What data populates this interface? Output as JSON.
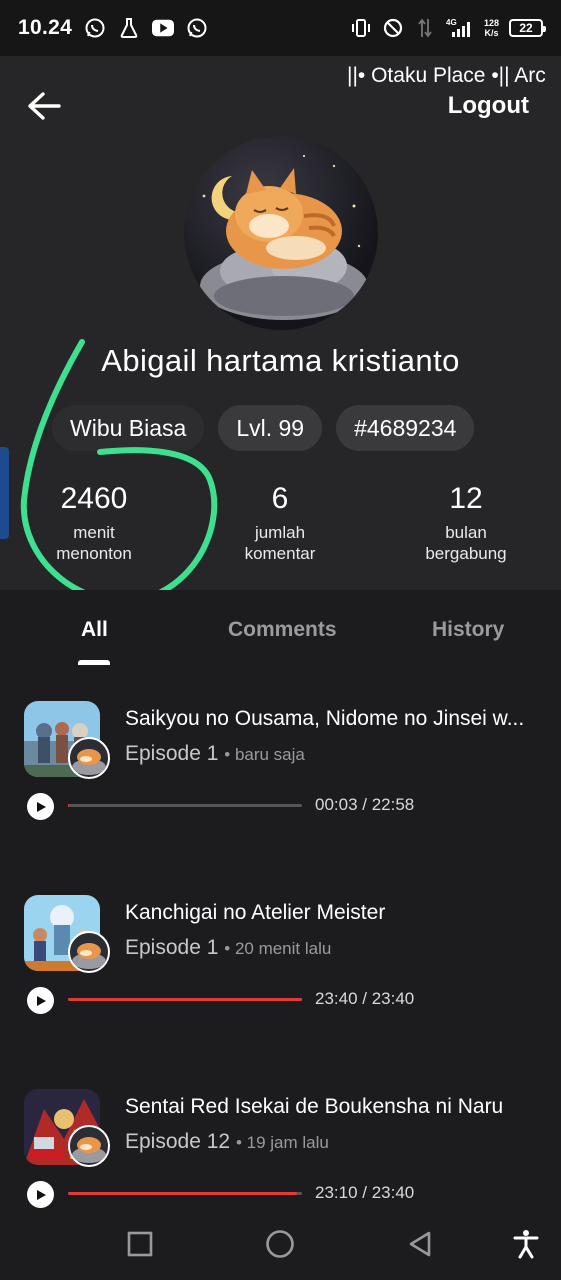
{
  "status_bar": {
    "time": "10.24",
    "left_icons": [
      "whatsapp-icon",
      "flask-icon",
      "youtube-icon",
      "whatsapp-icon"
    ],
    "network": "4G",
    "net_speed_value": "128",
    "net_speed_unit": "K/s",
    "battery": "22"
  },
  "header": {
    "marquee": "||• Otaku Place •|| Arc",
    "logout_label": "Logout"
  },
  "profile": {
    "username": "Abigail hartama kristianto",
    "badges": [
      "Wibu Biasa",
      "Lvl. 99",
      "#4689234"
    ],
    "stats": [
      {
        "value": "2460",
        "label_line1": "menit",
        "label_line2": "menonton"
      },
      {
        "value": "6",
        "label_line1": "jumlah",
        "label_line2": "komentar"
      },
      {
        "value": "12",
        "label_line1": "bulan",
        "label_line2": "bergabung"
      }
    ]
  },
  "tabs": [
    "All",
    "Comments",
    "History"
  ],
  "active_tab": "All",
  "history": [
    {
      "title": "Saikyou no Ousama, Nidome no Jinsei w...",
      "episode": "Episode 1",
      "time_ago": "baru saja",
      "progress_text": "00:03 / 22:58",
      "progress": 0.002
    },
    {
      "title": "Kanchigai no Atelier Meister",
      "episode": "Episode 1",
      "time_ago": "20 menit lalu",
      "progress_text": "23:40 / 23:40",
      "progress": 1.0
    },
    {
      "title": "Sentai Red Isekai de Boukensha ni Naru",
      "episode": "Episode 12",
      "time_ago": "19 jam lalu",
      "progress_text": "23:10 / 23:40",
      "progress": 0.979
    }
  ],
  "colors": {
    "accent_red": "#e53935",
    "annotation_green": "#3ee08f",
    "badge_bg": "#3a3a3c"
  },
  "navbar": [
    "square-icon",
    "circle-icon",
    "triangle-back-icon",
    "accessibility-icon"
  ]
}
